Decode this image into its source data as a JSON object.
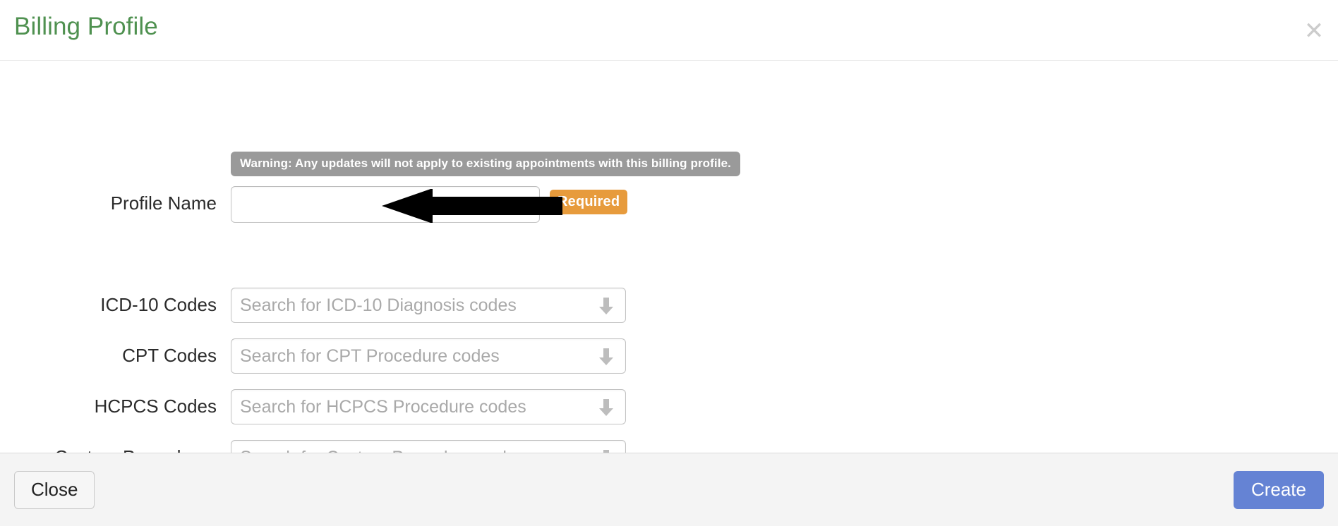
{
  "modal": {
    "title": "Billing Profile",
    "close_icon": "close-icon",
    "close_glyph": "✕"
  },
  "warning": {
    "text": "Warning: Any updates will not apply to existing appointments with this billing profile.",
    "background_color": "#9a9a9a",
    "text_color": "#ffffff"
  },
  "form": {
    "profile_name": {
      "label": "Profile Name",
      "value": "",
      "placeholder": "",
      "inner_icon": "card-keyboard-icon",
      "badge": {
        "text": "Required",
        "color": "#e79b3c"
      }
    },
    "selects": [
      {
        "label": "ICD-10 Codes",
        "placeholder": "Search for ICD-10 Diagnosis codes",
        "value": "",
        "caret_icon": "arrow-down-icon"
      },
      {
        "label": "CPT Codes",
        "placeholder": "Search for CPT Procedure codes",
        "value": "",
        "caret_icon": "arrow-down-icon"
      },
      {
        "label": "HCPCS Codes",
        "placeholder": "Search for HCPCS Procedure codes",
        "value": "",
        "caret_icon": "arrow-down-icon"
      },
      {
        "label": "Custom Procedures",
        "placeholder": "Search for Custom Procedure codes",
        "value": "",
        "caret_icon": "arrow-down-icon"
      }
    ]
  },
  "annotation": {
    "arrow_icon": "left-pointing-arrow-annotation",
    "color": "#000000"
  },
  "footer": {
    "close_label": "Close",
    "create_label": "Create",
    "create_color": "#6583d4"
  },
  "theme": {
    "title_color": "#4f9150",
    "footer_background": "#f4f4f4"
  }
}
